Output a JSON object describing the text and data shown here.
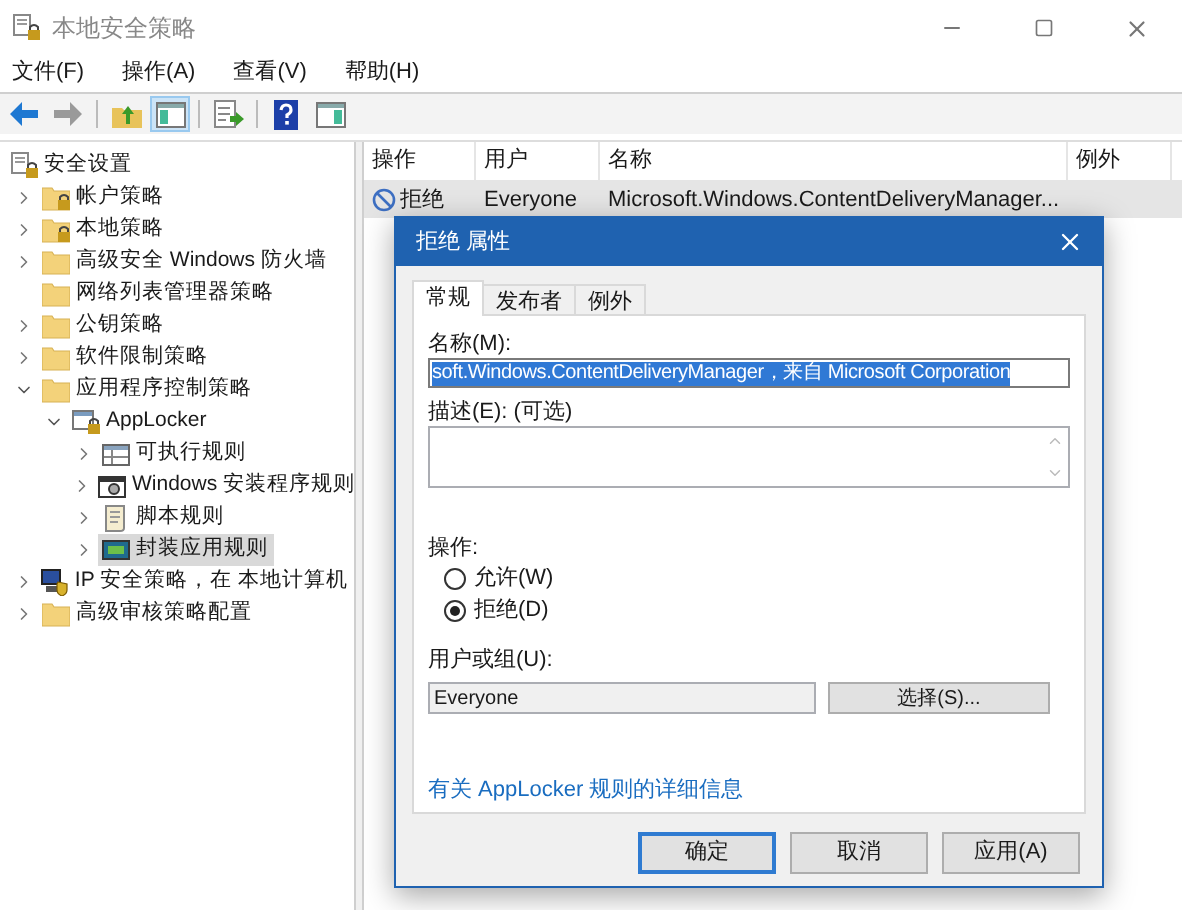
{
  "window": {
    "title": "本地安全策略"
  },
  "menu": [
    "文件(F)",
    "操作(A)",
    "查看(V)",
    "帮助(H)"
  ],
  "toolbar": [
    {
      "kind": "back",
      "disabled": false,
      "pressed": false
    },
    {
      "kind": "forward",
      "disabled": true,
      "pressed": false
    },
    {
      "kind": "up",
      "disabled": false,
      "pressed": false
    },
    {
      "kind": "tree",
      "disabled": false,
      "pressed": true
    },
    {
      "kind": "export",
      "disabled": false,
      "pressed": false
    },
    {
      "kind": "help",
      "disabled": false,
      "pressed": false
    },
    {
      "kind": "pane",
      "disabled": false,
      "pressed": false
    }
  ],
  "tree": {
    "label": "安全设置",
    "kind": "security",
    "children": [
      {
        "label": "帐户策略",
        "kind": "folder-lock",
        "expandable": true,
        "expanded": false,
        "selected": false
      },
      {
        "label": "本地策略",
        "kind": "folder-lock",
        "expandable": true,
        "expanded": false,
        "selected": false
      },
      {
        "label": "高级安全 Windows 防火墙",
        "kind": "folder",
        "expandable": true,
        "expanded": false,
        "selected": false
      },
      {
        "label": "网络列表管理器策略",
        "kind": "folder",
        "expandable": false,
        "expanded": false,
        "selected": false
      },
      {
        "label": "公钥策略",
        "kind": "folder",
        "expandable": true,
        "expanded": false,
        "selected": false
      },
      {
        "label": "软件限制策略",
        "kind": "folder",
        "expandable": true,
        "expanded": false,
        "selected": false
      },
      {
        "label": "应用程序控制策略",
        "kind": "folder",
        "expandable": true,
        "expanded": true,
        "selected": false,
        "children": [
          {
            "label": "AppLocker",
            "kind": "applocker",
            "expandable": true,
            "expanded": true,
            "selected": false,
            "children": [
              {
                "label": "可执行规则",
                "kind": "table",
                "expandable": true,
                "expanded": false,
                "selected": false
              },
              {
                "label": "Windows 安装程序规则",
                "kind": "installer",
                "expandable": true,
                "expanded": false,
                "selected": false
              },
              {
                "label": "脚本规则",
                "kind": "script",
                "expandable": true,
                "expanded": false,
                "selected": false
              },
              {
                "label": "封装应用规则",
                "kind": "package",
                "expandable": true,
                "expanded": false,
                "selected": true
              }
            ]
          }
        ]
      },
      {
        "label": "IP 安全策略，在 本地计算机",
        "kind": "ip",
        "expandable": true,
        "expanded": false,
        "selected": false
      },
      {
        "label": "高级审核策略配置",
        "kind": "folder",
        "expandable": true,
        "expanded": false,
        "selected": false
      }
    ]
  },
  "list": {
    "columns": [
      "操作",
      "用户",
      "名称",
      "例外"
    ],
    "rows": [
      {
        "kind": "deny",
        "selected": true,
        "cells": [
          "拒绝",
          "Everyone",
          "Microsoft.Windows.ContentDeliveryManager..."
        ]
      }
    ]
  },
  "dialog": {
    "title": "拒绝 属性",
    "tabs": [
      {
        "label": "常规",
        "selected": true
      },
      {
        "label": "发布者",
        "selected": false
      },
      {
        "label": "例外",
        "selected": false
      }
    ],
    "name_label": "名称(M):",
    "name_value": "soft.Windows.ContentDeliveryManager，来自 Microsoft Corporation",
    "name_text_selected": true,
    "description_label": "描述(E): (可选)",
    "action_label": "操作:",
    "radios": [
      {
        "label": "允许(W)",
        "selected": false
      },
      {
        "label": "拒绝(D)",
        "selected": true
      }
    ],
    "user_label": "用户或组(U):",
    "user_value": "Everyone",
    "select_button": "选择(S)...",
    "link": "有关 AppLocker 规则的详细信息",
    "buttons": [
      {
        "label": "确定",
        "default": true
      },
      {
        "label": "取消",
        "default": false
      },
      {
        "label": "应用(A)",
        "default": false
      }
    ]
  }
}
